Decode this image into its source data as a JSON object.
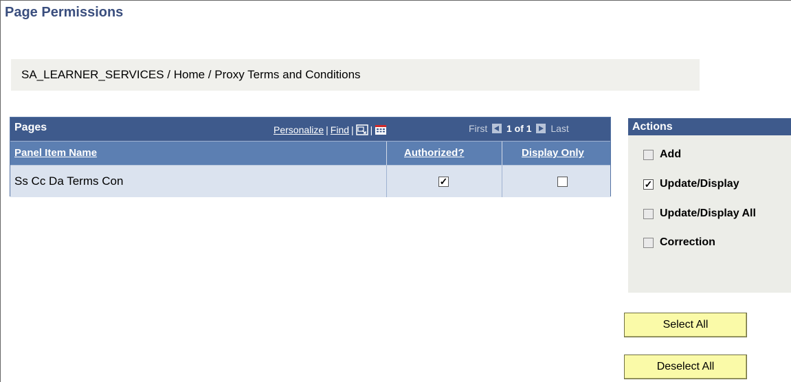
{
  "page": {
    "title": "Page Permissions",
    "breadcrumb": "SA_LEARNER_SERVICES / Home / Proxy Terms and Conditions"
  },
  "pages_grid": {
    "title": "Pages",
    "personalize_label": "Personalize",
    "find_label": "Find",
    "separator": "|",
    "first_label": "First",
    "page_indicator": "1 of 1",
    "last_label": "Last",
    "columns": [
      "Panel Item Name",
      "Authorized?",
      "Display Only"
    ],
    "rows": [
      {
        "panel_item_name": "Ss Cc Da Terms Con",
        "authorized": true,
        "display_only": false
      }
    ],
    "icons": [
      "view-all-icon",
      "download-icon"
    ]
  },
  "actions": {
    "title": "Actions",
    "items": [
      {
        "label": "Add",
        "checked": false,
        "enabled": false
      },
      {
        "label": "Update/Display",
        "checked": true,
        "enabled": true
      },
      {
        "label": "Update/Display All",
        "checked": false,
        "enabled": false
      },
      {
        "label": "Correction",
        "checked": false,
        "enabled": false
      }
    ]
  },
  "buttons": {
    "select_all": "Select All",
    "deselect_all": "Deselect All"
  },
  "colors": {
    "header_blue": "#3e5a8c",
    "column_blue": "#5c7fb2",
    "row_bg": "#dbe3ef",
    "button_yellow": "#fafaa8",
    "title_color": "#3a4e7e"
  }
}
